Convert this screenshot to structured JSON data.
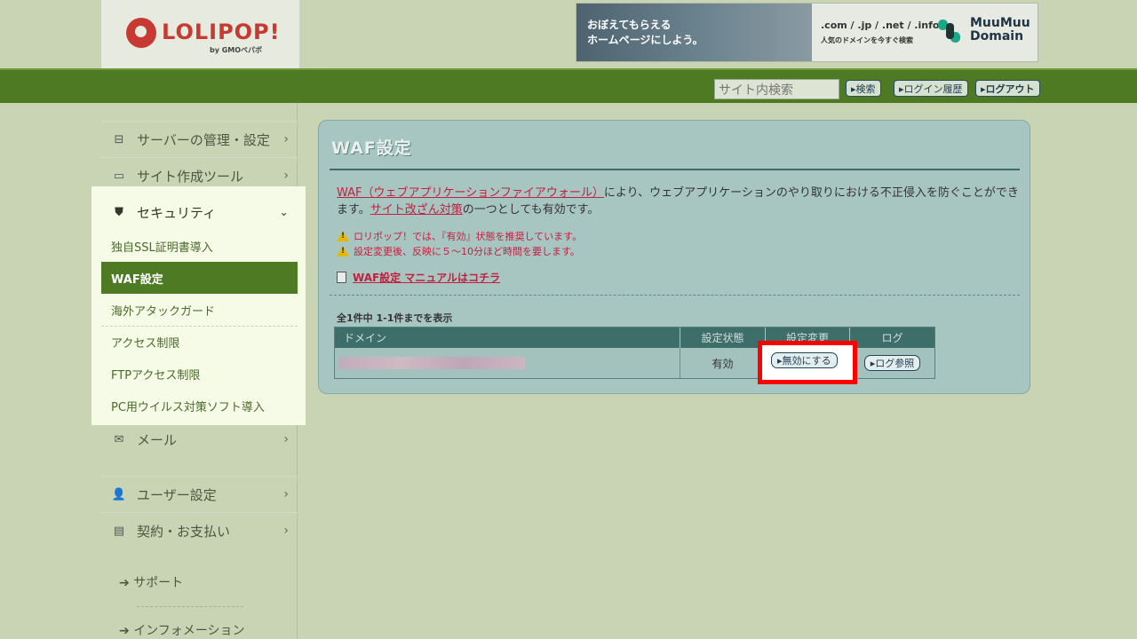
{
  "header": {
    "logo_text": "LOLIPOP!",
    "logo_sub": "by GMOペパボ",
    "banner_left_text": "おぼえてもらえる\nホームページにしよう。",
    "banner_domains": ".com / .jp / .net / .info",
    "banner_domains_sub": "人気のドメインを今すぐ検索",
    "banner_brand": "MuuMuu Domain",
    "search_placeholder": "サイト内検索",
    "search_button": "▸検索",
    "login_history_button": "▸ログイン履歴",
    "logout_button": "▸ログアウト"
  },
  "sidebar": {
    "server": "サーバーの管理・設定",
    "site_tools": "サイト作成ツール",
    "security": "セキュリティ",
    "security_items": [
      "独自SSL証明書導入",
      "WAF設定",
      "海外アタックガード",
      "アクセス制限",
      "FTPアクセス制限",
      "PC用ウイルス対策ソフト導入"
    ],
    "mail": "メール",
    "user_settings": "ユーザー設定",
    "contract": "契約・お支払い",
    "support": "サポート",
    "information": "インフォメーション"
  },
  "main": {
    "title": "WAF設定",
    "desc_link1": "WAF（ウェブアプリケーションファイアウォール）",
    "desc_text1": "により、ウェブアプリケーションのやり取りにおける不正侵入を防ぐことができます。",
    "desc_link2": "サイト改ざん対策",
    "desc_text2": "の一つとしても有効です。",
    "warning1": "ロリポップ！では、『有効』状態を推奨しています。",
    "warning2": "設定変更後、反映に５～10分ほど時間を要します。",
    "manual_link": "WAF設定 マニュアルはコチラ",
    "count_text": "全1件中 1-1件までを表示",
    "table": {
      "headers": [
        "ドメイン",
        "設定状態",
        "設定変更",
        "ログ"
      ],
      "row": {
        "status": "有効",
        "change_button": "▸無効にする",
        "log_button": "▸ログ参照"
      }
    }
  }
}
